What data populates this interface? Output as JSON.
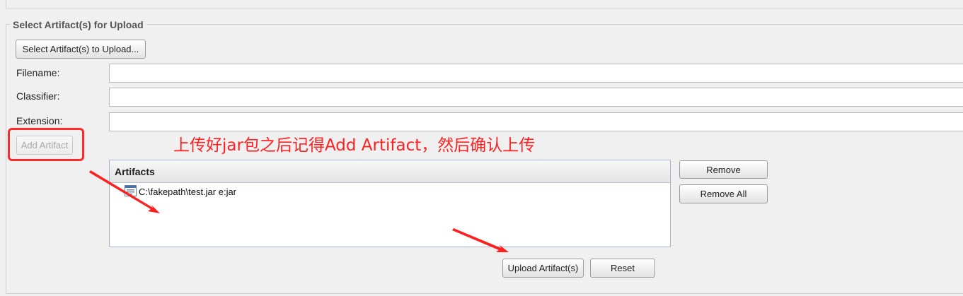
{
  "section": {
    "title": "Select Artifact(s) for Upload"
  },
  "buttons": {
    "select": "Select Artifact(s) to Upload...",
    "add": "Add Artifact",
    "remove": "Remove",
    "remove_all": "Remove All",
    "upload": "Upload Artifact(s)",
    "reset": "Reset"
  },
  "fields": {
    "filename": {
      "label": "Filename:",
      "value": ""
    },
    "classifier": {
      "label": "Classifier:",
      "value": ""
    },
    "extension": {
      "label": "Extension:",
      "value": ""
    }
  },
  "annotation": "上传好jar包之后记得Add Artifact，然后确认上传",
  "artifacts": {
    "header": "Artifacts",
    "items": [
      {
        "label": "C:\\fakepath\\test.jar e:jar",
        "icon": "file-list-icon"
      }
    ]
  },
  "colors": {
    "annotation": "#ff2222",
    "panel_border": "#a8b5c8"
  }
}
